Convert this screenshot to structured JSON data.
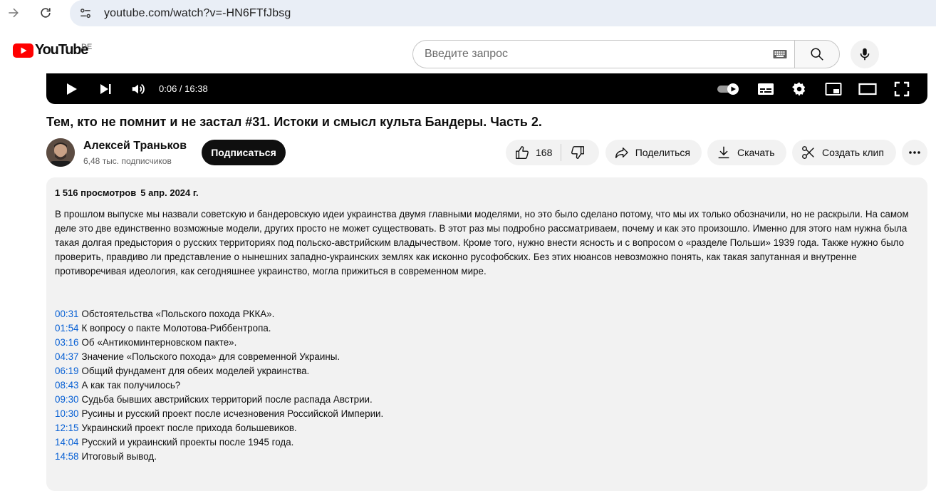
{
  "browser": {
    "url": "youtube.com/watch?v=-HN6FTfJbsg"
  },
  "header": {
    "logo_text": "YouTube",
    "region": "DE",
    "search_placeholder": "Введите запрос"
  },
  "player": {
    "time": "0:06 / 16:38"
  },
  "video": {
    "title": "Тем, кто не помнит и не застал #31. Истоки и смысл культа Бандеры. Часть 2."
  },
  "channel": {
    "name": "Алексей Траньков",
    "subscribers": "6,48 тыс. подписчиков",
    "subscribe_label": "Подписаться"
  },
  "actions": {
    "likes": "168",
    "share_label": "Поделиться",
    "download_label": "Скачать",
    "clip_label": "Создать клип"
  },
  "description": {
    "views": "1 516 просмотров",
    "date": "5 апр. 2024 г.",
    "text": "В прошлом выпуске мы назвали советскую и бандеровскую идеи украинства двумя главными моделями, но это было сделано потому, что мы их только обозначили, но не раскрыли. На самом деле это две единственно возможные модели, других просто не может существовать. В этот раз мы подробно рассматриваем, почему и как это произошло. Именно для этого нам нужна была такая долгая предыстория о русских территориях под польско-австрийским владычеством. Кроме того, нужно внести ясность и с вопросом о «разделе Польши» 1939 года. Также нужно было проверить, правдиво ли представление о нынешних западно-украинских землях как исконно русофобских. Без этих нюансов невозможно понять, как такая запутанная и внутренне противоречивая идеология, как сегодняшнее украинство, могла прижиться в современном мире.",
    "chapters": [
      {
        "time": "00:31",
        "title": "Обстоятельства «Польского похода РККА»."
      },
      {
        "time": "01:54",
        "title": "К вопросу о пакте Молотова-Риббентропа."
      },
      {
        "time": "03:16",
        "title": "Об «Антикоминтерновском пакте»."
      },
      {
        "time": "04:37",
        "title": "Значение «Польского похода» для современной Украины."
      },
      {
        "time": "06:19",
        "title": "Общий фундамент для обеих моделей украинства."
      },
      {
        "time": "08:43",
        "title": "А как так получилось?"
      },
      {
        "time": "09:30",
        "title": "Судьба бывших австрийских территорий после распада Австрии."
      },
      {
        "time": "10:30",
        "title": "Русины и русский проект после исчезновения Российской Империи."
      },
      {
        "time": "12:15",
        "title": "Украинский проект после прихода большевиков."
      },
      {
        "time": "14:04",
        "title": "Русский и украинский проекты после 1945 года."
      },
      {
        "time": "14:58",
        "title": "Итоговый вывод."
      }
    ]
  },
  "colors": {
    "timestamp_link": "#065fd4",
    "brand_red": "#ff0000"
  }
}
